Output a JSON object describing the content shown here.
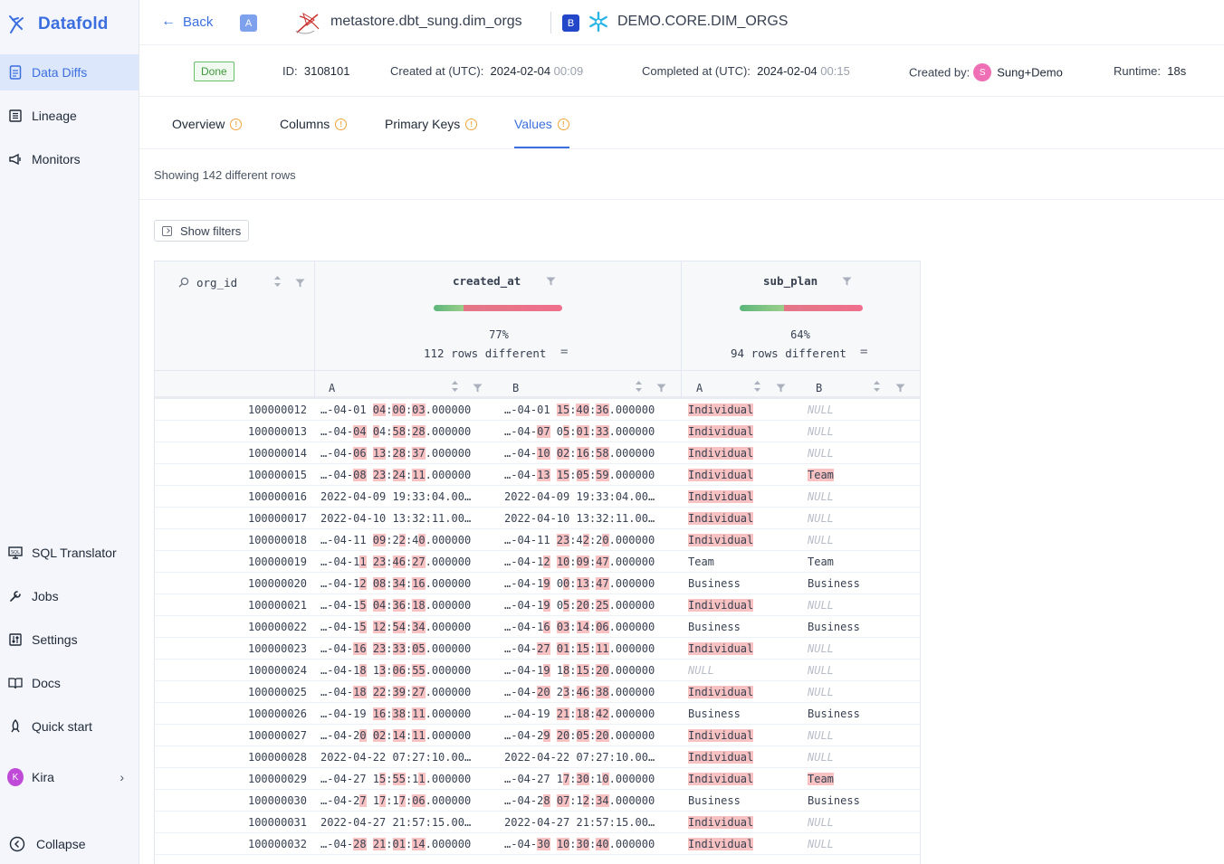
{
  "app": {
    "brand": "Datafold"
  },
  "sidebar": {
    "items": [
      {
        "label": "Data Diffs",
        "icon": "doc-icon"
      },
      {
        "label": "Lineage",
        "icon": "list-icon"
      },
      {
        "label": "Monitors",
        "icon": "megaphone-icon"
      },
      {
        "label": "SQL Translator",
        "icon": "sql-icon"
      },
      {
        "label": "Jobs",
        "icon": "wrench-icon"
      },
      {
        "label": "Settings",
        "icon": "sliders-icon"
      },
      {
        "label": "Docs",
        "icon": "book-icon"
      },
      {
        "label": "Quick start",
        "icon": "rocket-icon"
      }
    ],
    "user": {
      "name": "Kira",
      "initial": "K"
    },
    "collapse": "Collapse"
  },
  "header": {
    "back": "Back",
    "tag_a": "A",
    "dataset_a": "metastore.dbt_sung.dim_orgs",
    "tag_b": "B",
    "dataset_b": "DEMO.CORE.DIM_ORGS"
  },
  "meta": {
    "status": "Done",
    "id_label": "ID:",
    "id": "3108101",
    "created_label": "Created at (UTC):",
    "created_date": "2024-02-04",
    "created_time": "00:09",
    "completed_label": "Completed at (UTC):",
    "completed_date": "2024-02-04",
    "completed_time": "00:15",
    "created_by_label": "Created by:",
    "created_by_initial": "S",
    "created_by": "Sung+Demo",
    "runtime_label": "Runtime:",
    "runtime": "18s"
  },
  "tabs": [
    {
      "label": "Overview",
      "warning": true
    },
    {
      "label": "Columns",
      "warning": true
    },
    {
      "label": "Primary Keys",
      "warning": true
    },
    {
      "label": "Values",
      "warning": true,
      "active": true
    }
  ],
  "summary": "Showing 142 different rows",
  "filters_button": "Show filters",
  "colors": {
    "accent": "#3b6fe0",
    "diff_highlight": "#f8c2c2",
    "match": "#5bb67a",
    "mismatch": "#f0708c"
  },
  "grid": {
    "key_column": "org_id",
    "columns": [
      {
        "name": "created_at",
        "pct": "77%",
        "pct_value": 0.77,
        "rows_different": "112 rows different",
        "sub_a": "A",
        "sub_b": "B"
      },
      {
        "name": "sub_plan",
        "pct": "64%",
        "pct_value": 0.64,
        "rows_different": "94 rows different",
        "sub_a": "A",
        "sub_b": "B"
      }
    ],
    "rows": [
      {
        "id": "100000012",
        "ca": "…-04-01 [04]:[00]:[03].000000",
        "cb": "…-04-01 [15]:[40]:[36].000000",
        "sa": "[Individual]",
        "sb": "NULL"
      },
      {
        "id": "100000013",
        "ca": "…-04-[04] [0]4:[58]:[28].000000",
        "cb": "…-04-[07] 0[5]:[01]:[33].000000",
        "sa": "[Individual]",
        "sb": "NULL"
      },
      {
        "id": "100000014",
        "ca": "…-04-[06] [13]:[28]:[37].000000",
        "cb": "…-04-[10] [02]:[16]:[58].000000",
        "sa": "[Individual]",
        "sb": "NULL"
      },
      {
        "id": "100000015",
        "ca": "…-04-[08] [23]:[24]:[11].000000",
        "cb": "…-04-[13] [15]:[05]:[59].000000",
        "sa": "[Individual]",
        "sb": "[Team]"
      },
      {
        "id": "100000016",
        "ca": "2022-04-09 19:33:04.00…",
        "cb": "2022-04-09 19:33:04.00…",
        "sa": "[Individual]",
        "sb": "NULL"
      },
      {
        "id": "100000017",
        "ca": "2022-04-10 13:32:11.00…",
        "cb": "2022-04-10 13:32:11.00…",
        "sa": "[Individual]",
        "sb": "NULL"
      },
      {
        "id": "100000018",
        "ca": "…-04-11 [09]:2[2]:4[0].000000",
        "cb": "…-04-11 [23]:4[2]:2[0].000000",
        "sa": "[Individual]",
        "sb": "NULL"
      },
      {
        "id": "100000019",
        "ca": "…-04-1[1] [23]:[46]:[27].000000",
        "cb": "…-04-1[2] [10]:[09]:[47].000000",
        "sa": "Team",
        "sb": "Team"
      },
      {
        "id": "100000020",
        "ca": "…-04-1[2] [08]:[34]:[16].000000",
        "cb": "…-04-1[9] 0[0]:[13]:[47].000000",
        "sa": "Business",
        "sb": "Business"
      },
      {
        "id": "100000021",
        "ca": "…-04-1[5] [04]:[36]:[18].000000",
        "cb": "…-04-1[9] 0[5]:[20]:[25].000000",
        "sa": "[Individual]",
        "sb": "NULL"
      },
      {
        "id": "100000022",
        "ca": "…-04-1[5] [12]:[54]:[34].000000",
        "cb": "…-04-1[6] [03]:[14]:[06].000000",
        "sa": "Business",
        "sb": "Business"
      },
      {
        "id": "100000023",
        "ca": "…-04-[16] [23]:[33]:[05].000000",
        "cb": "…-04-[27] [01]:[15]:[11].000000",
        "sa": "[Individual]",
        "sb": "NULL"
      },
      {
        "id": "100000024",
        "ca": "…-04-1[8] 1[3]:[06]:[55].000000",
        "cb": "…-04-1[9] 1[8]:[15]:[20].000000",
        "sa": "NULL",
        "sb": "NULL"
      },
      {
        "id": "100000025",
        "ca": "…-04-[18] [22]:[39]:[27].000000",
        "cb": "…-04-[20] 2[3]:[46]:[38].000000",
        "sa": "[Individual]",
        "sb": "NULL"
      },
      {
        "id": "100000026",
        "ca": "…-04-19 [16]:[38]:[11].000000",
        "cb": "…-04-19 [21]:[18]:[42].000000",
        "sa": "Business",
        "sb": "Business"
      },
      {
        "id": "100000027",
        "ca": "…-04-2[0] [02]:[14]:[11].000000",
        "cb": "…-04-2[9] [20]:[05]:[20].000000",
        "sa": "[Individual]",
        "sb": "NULL"
      },
      {
        "id": "100000028",
        "ca": "2022-04-22 07:27:10.00…",
        "cb": "2022-04-22 07:27:10.00…",
        "sa": "[Individual]",
        "sb": "NULL"
      },
      {
        "id": "100000029",
        "ca": "…-04-27 1[5]:[55]:1[1].000000",
        "cb": "…-04-27 1[7]:[30]:1[0].000000",
        "sa": "[Individual]",
        "sb": "[Team]"
      },
      {
        "id": "100000030",
        "ca": "…-04-2[7] 1[7]:1[7]:[06].000000",
        "cb": "…-04-2[8] [07]:1[2]:[34].000000",
        "sa": "Business",
        "sb": "Business"
      },
      {
        "id": "100000031",
        "ca": "2022-04-27 21:57:15.00…",
        "cb": "2022-04-27 21:57:15.00…",
        "sa": "[Individual]",
        "sb": "NULL"
      },
      {
        "id": "100000032",
        "ca": "…-04-[28] [21]:[01]:[14].000000",
        "cb": "…-04-[30] [10]:[30]:[40].000000",
        "sa": "[Individual]",
        "sb": "NULL"
      }
    ]
  }
}
